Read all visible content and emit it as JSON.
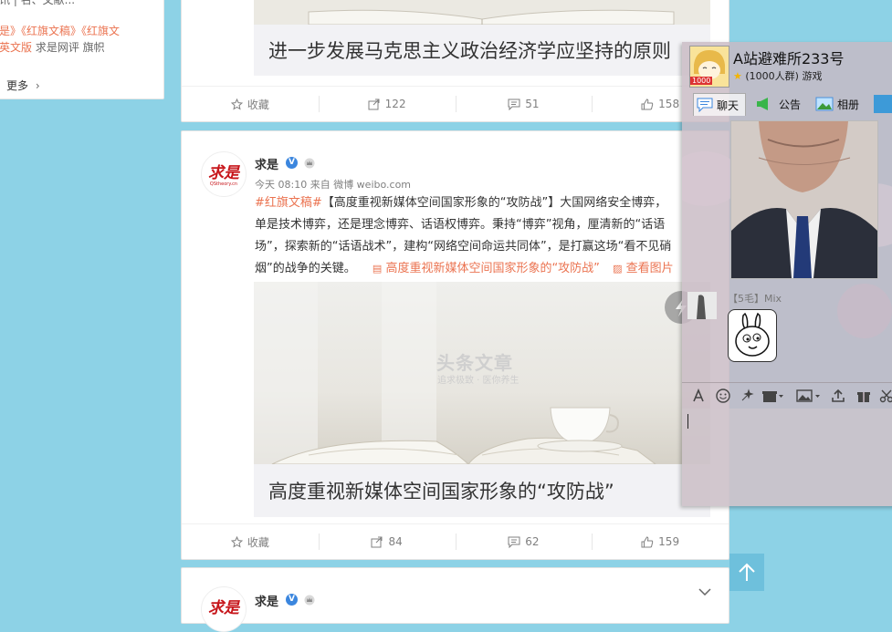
{
  "left_panel": {
    "line1": "讯 | 名、文献...",
    "line2": "是》《红旗文稿》《红旗文",
    "line3_red": "英文版 ",
    "line3_gray": "求是网评 旗帜",
    "more": "更多"
  },
  "post1": {
    "quote_title": "进一步发展马克思主义政治经济学应坚持的原则",
    "collect": "收藏",
    "forward": "122",
    "comments": "51",
    "likes": "158"
  },
  "post2": {
    "username": "求是",
    "avatar_text": "求是",
    "avatar_sub": "QStheory.cn",
    "meta": "今天 08:10 来自 微博 weibo.com",
    "hashtag": "#红旗文稿#",
    "line1_rest": "【高度重视新媒体空间国家形象的“攻防战”】大国网络安全博弈，",
    "line2": "单是技术博弈，还是理念博弈、话语权博弈。秉持“博弈”视角，厘清新的“话语",
    "line3": "场”，探索新的“话语战术”，建构“网络空间命运共同体”，是打赢这场“看不见硝",
    "line4_start": "烟”的战争的关键。",
    "article_link": "高度重视新媒体空间国家形象的“攻防战”",
    "view_image": "查看图片",
    "watermark_title": "头条文章",
    "watermark_sub": "追求极致 · 医你养生",
    "article_title": "高度重视新媒体空间国家形象的“攻防战”",
    "collect": "收藏",
    "forward": "84",
    "comments": "62",
    "likes": "159"
  },
  "post3": {
    "username": "求是",
    "avatar_text": "求是"
  },
  "chat": {
    "group_name": "A站避难所233号",
    "group_info": "(1000人群) 游戏",
    "avatar_badge": "1000",
    "tabs": [
      "聊天",
      "公告",
      "相册"
    ],
    "sender": "【5毛】Mix"
  }
}
